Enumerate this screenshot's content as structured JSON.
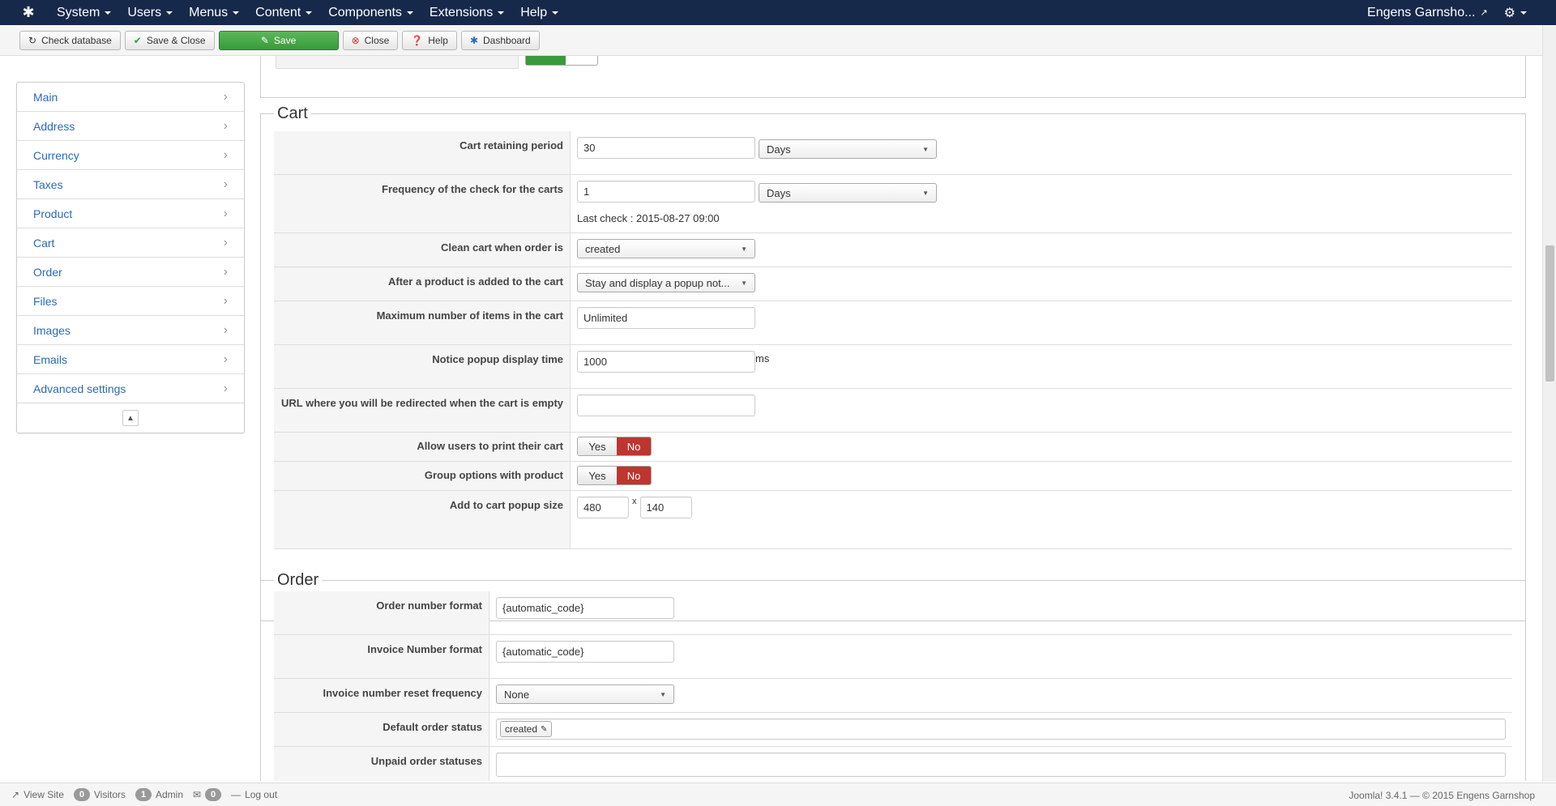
{
  "navbar": {
    "menu": [
      "System",
      "Users",
      "Menus",
      "Content",
      "Components",
      "Extensions",
      "Help"
    ],
    "user": "Engens Garnsho..."
  },
  "toolbar": {
    "check_database": "Check database",
    "save_close": "Save & Close",
    "save": "Save",
    "close": "Close",
    "help": "Help",
    "dashboard": "Dashboard"
  },
  "sidebar": {
    "items": [
      "Main",
      "Address",
      "Currency",
      "Taxes",
      "Product",
      "Cart",
      "Order",
      "Files",
      "Images",
      "Emails",
      "Advanced settings"
    ]
  },
  "cart": {
    "legend": "Cart",
    "retaining_label": "Cart retaining period",
    "retaining_value": "30",
    "retaining_unit": "Days",
    "frequency_label": "Frequency of the check for the carts",
    "frequency_value": "1",
    "frequency_unit": "Days",
    "last_check": "Last check : 2015-08-27 09:00",
    "clean_label": "Clean cart when order is",
    "clean_value": "created",
    "after_add_label": "After a product is added to the cart",
    "after_add_value": "Stay and display a popup not...",
    "max_items_label": "Maximum number of items in the cart",
    "max_items_value": "Unlimited",
    "popup_time_label": "Notice popup display time",
    "popup_time_value": "1000",
    "popup_time_unit": "ms",
    "empty_url_label": "URL where you will be redirected when the cart is empty",
    "empty_url_value": "",
    "print_label": "Allow users to print their cart",
    "group_label": "Group options with product",
    "yes": "Yes",
    "no": "No",
    "popup_size_label": "Add to cart popup size",
    "popup_width": "480",
    "popup_x": "x",
    "popup_height": "140"
  },
  "order": {
    "legend": "Order",
    "number_format_label": "Order number format",
    "number_format_value": "{automatic_code}",
    "invoice_format_label": "Invoice Number format",
    "invoice_format_value": "{automatic_code}",
    "reset_label": "Invoice number reset frequency",
    "reset_value": "None",
    "default_status_label": "Default order status",
    "default_status_value": "created",
    "unpaid_label": "Unpaid order statuses"
  },
  "statusbar": {
    "view_site": "View Site",
    "visitors_count": "0",
    "visitors": "Visitors",
    "admin_count": "1",
    "admin": "Admin",
    "messages_count": "0",
    "logout": "Log out",
    "copyright": "Joomla! 3.4.1  —  © 2015 Engens Garnshop"
  },
  "colors": {
    "navbar": "#17294a",
    "save_button": "#3a9a3a",
    "no_active": "#bd362f",
    "link": "#2a69b8"
  }
}
